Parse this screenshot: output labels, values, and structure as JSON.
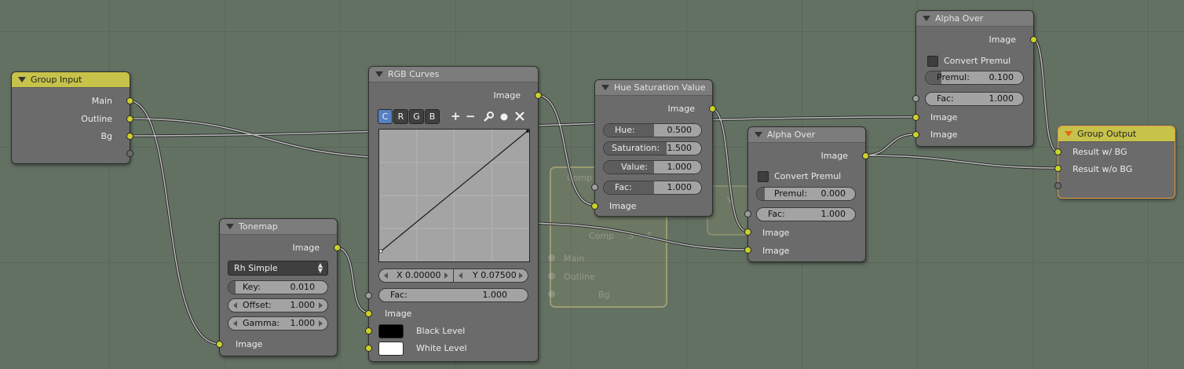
{
  "group_input": {
    "title": "Group Input",
    "outputs": [
      "Main",
      "Outline",
      "Bg"
    ]
  },
  "tonemap": {
    "title": "Tonemap",
    "output": "Image",
    "type_value": "Rh Simple",
    "key_label": "Key:",
    "key_value": "0.010",
    "offset_label": "Offset:",
    "offset_value": "1.000",
    "gamma_label": "Gamma:",
    "gamma_value": "1.000",
    "input": "Image"
  },
  "rgb_curves": {
    "title": "RGB Curves",
    "output": "Image",
    "channels": [
      "C",
      "R",
      "G",
      "B"
    ],
    "tools": [
      "+",
      "−",
      "wrench-icon",
      "dot-icon",
      "close-icon"
    ],
    "x_readout": "X 0.00000",
    "y_readout": "Y 0.07500",
    "fac_label": "Fac:",
    "fac_value": "1.000",
    "input_image": "Image",
    "black_level": "Black Level",
    "white_level": "White Level",
    "black_color": "#000000",
    "white_color": "#ffffff"
  },
  "ghost_node": {
    "title": "Comp",
    "row_left": "Comp",
    "row_num": "3",
    "row_f": "F",
    "items": [
      "Main",
      "Outline",
      "Bg"
    ],
    "side_label": "V"
  },
  "hsv": {
    "title": "Hue Saturation Value",
    "output": "Image",
    "hue_label": "Hue:",
    "hue_value": "0.500",
    "sat_label": "Saturation:",
    "sat_value": "1.500",
    "val_label": "Value:",
    "val_value": "1.000",
    "fac_label": "Fac:",
    "fac_value": "1.000",
    "input": "Image"
  },
  "alpha_over_1": {
    "title": "Alpha Over",
    "output": "Image",
    "convert_label": "Convert Premul",
    "premul_label": "Premul:",
    "premul_value": "0.000",
    "fac_label": "Fac:",
    "fac_value": "1.000",
    "input_a": "Image",
    "input_b": "Image"
  },
  "alpha_over_2": {
    "title": "Alpha Over",
    "output": "Image",
    "convert_label": "Convert Premul",
    "premul_label": "Premul:",
    "premul_value": "0.100",
    "fac_label": "Fac:",
    "fac_value": "1.000",
    "input_a": "Image",
    "input_b": "Image"
  },
  "group_output": {
    "title": "Group Output",
    "inputs": [
      "Result w/ BG",
      "Result w/o BG"
    ]
  },
  "colors": {
    "background": "#637163",
    "node_body": "#6b6b6b",
    "socket_image": "#ccd12a",
    "socket_value": "#9d9d9d",
    "group_header": "#c7c24a",
    "selected_outline": "#e49a3d",
    "active_channel": "#5680c2"
  }
}
